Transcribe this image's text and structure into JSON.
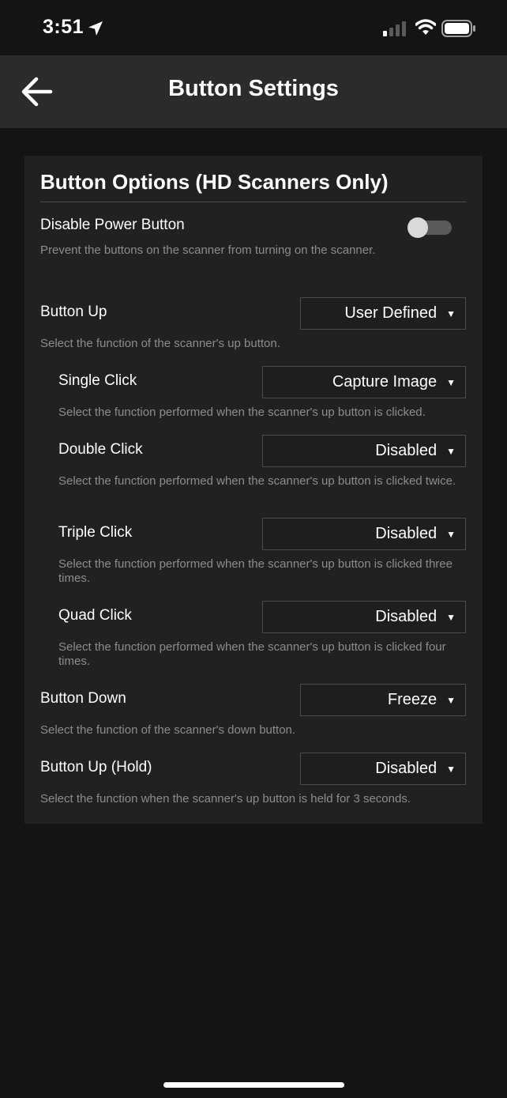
{
  "status_bar": {
    "time": "3:51"
  },
  "nav": {
    "title": "Button Settings"
  },
  "card": {
    "title": "Button Options (HD Scanners Only)",
    "disable_power": {
      "label": "Disable Power Button",
      "description": "Prevent the buttons on the scanner from turning on the scanner.",
      "enabled": false
    },
    "button_up": {
      "label": "Button Up",
      "value": "User Defined",
      "description": "Select the function of the scanner's up button."
    },
    "single_click": {
      "label": "Single Click",
      "value": "Capture Image",
      "description": "Select the function performed when the scanner's up button is clicked."
    },
    "double_click": {
      "label": "Double Click",
      "value": "Disabled",
      "description": "Select the function performed when the scanner's up button is clicked twice."
    },
    "triple_click": {
      "label": "Triple Click",
      "value": "Disabled",
      "description": "Select the function performed when the scanner's up button is clicked three times."
    },
    "quad_click": {
      "label": "Quad Click",
      "value": "Disabled",
      "description": "Select the function performed when the scanner's up button is clicked four times."
    },
    "button_down": {
      "label": "Button Down",
      "value": "Freeze",
      "description": "Select the function of the scanner's down button."
    },
    "button_up_hold": {
      "label": "Button Up (Hold)",
      "value": "Disabled",
      "description": "Select the function when the scanner's up button is held for 3 seconds."
    }
  },
  "colors": {
    "background": "#141414",
    "nav_background": "#2b2b2b",
    "card_background": "#212121",
    "description_text": "#8c8c8c"
  }
}
